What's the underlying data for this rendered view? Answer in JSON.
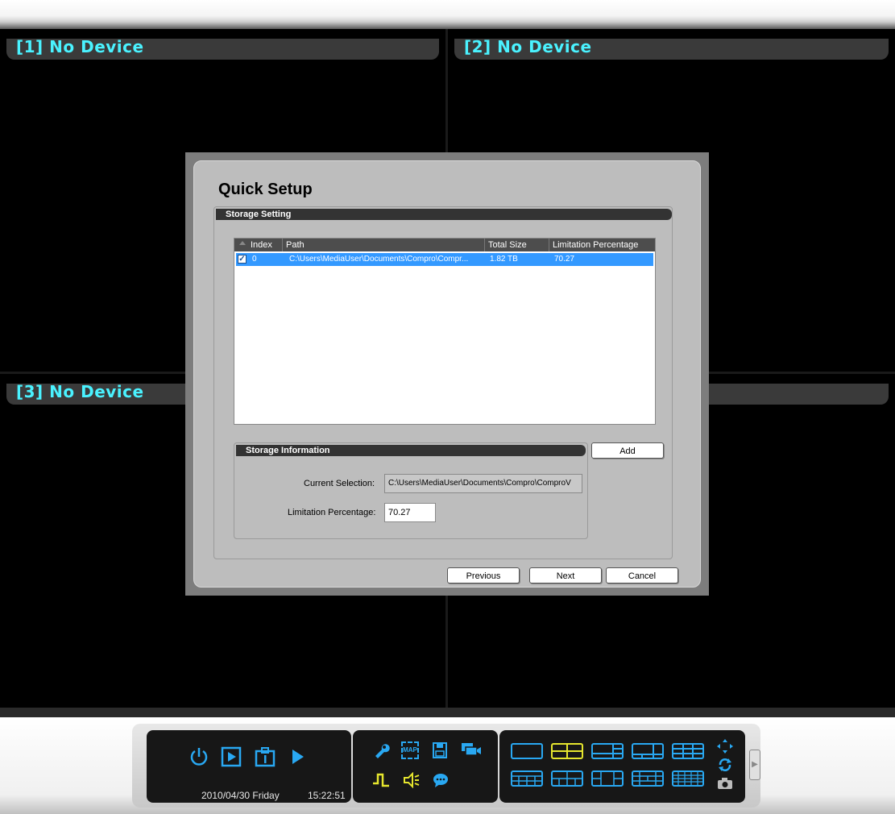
{
  "panels": [
    {
      "title": "[1] No Device"
    },
    {
      "title": "[2] No Device"
    },
    {
      "title": "[3] No Device"
    },
    {
      "title": ""
    }
  ],
  "dialog": {
    "title": "Quick Setup",
    "storage_setting": {
      "header": "Storage Setting",
      "columns": [
        "Index",
        "Path",
        "Total Size",
        "Limitation Percentage"
      ],
      "rows": [
        {
          "checked": true,
          "index": "0",
          "path": "C:\\Users\\MediaUser\\Documents\\Compro\\Compr...",
          "total_size": "1.82 TB",
          "limitation": "70.27"
        }
      ]
    },
    "storage_information": {
      "header": "Storage Information",
      "current_selection_label": "Current Selection:",
      "current_selection_value": "C:\\Users\\MediaUser\\Documents\\Compro\\ComproV",
      "limitation_label": "Limitation Percentage:",
      "limitation_value": "70.27"
    },
    "add_button": "Add",
    "previous_button": "Previous",
    "next_button": "Next",
    "cancel_button": "Cancel"
  },
  "status": {
    "date": "2010/04/30 Friday",
    "time": "15:22:51"
  },
  "toolbar": {
    "map_label": "MAP"
  },
  "colors": {
    "panel_title": "#4af2ff",
    "icon_blue": "#29a8f2",
    "icon_yellow": "#e6e62e",
    "selection": "#3399ff"
  },
  "icons": [
    "power-icon",
    "playback-icon",
    "info-icon",
    "play-icon",
    "settings-icon",
    "map-icon",
    "save-icon",
    "cameras-icon",
    "sensor-icon",
    "speaker-icon",
    "chat-icon",
    "ptz-icon",
    "rotate-icon",
    "snapshot-icon"
  ]
}
